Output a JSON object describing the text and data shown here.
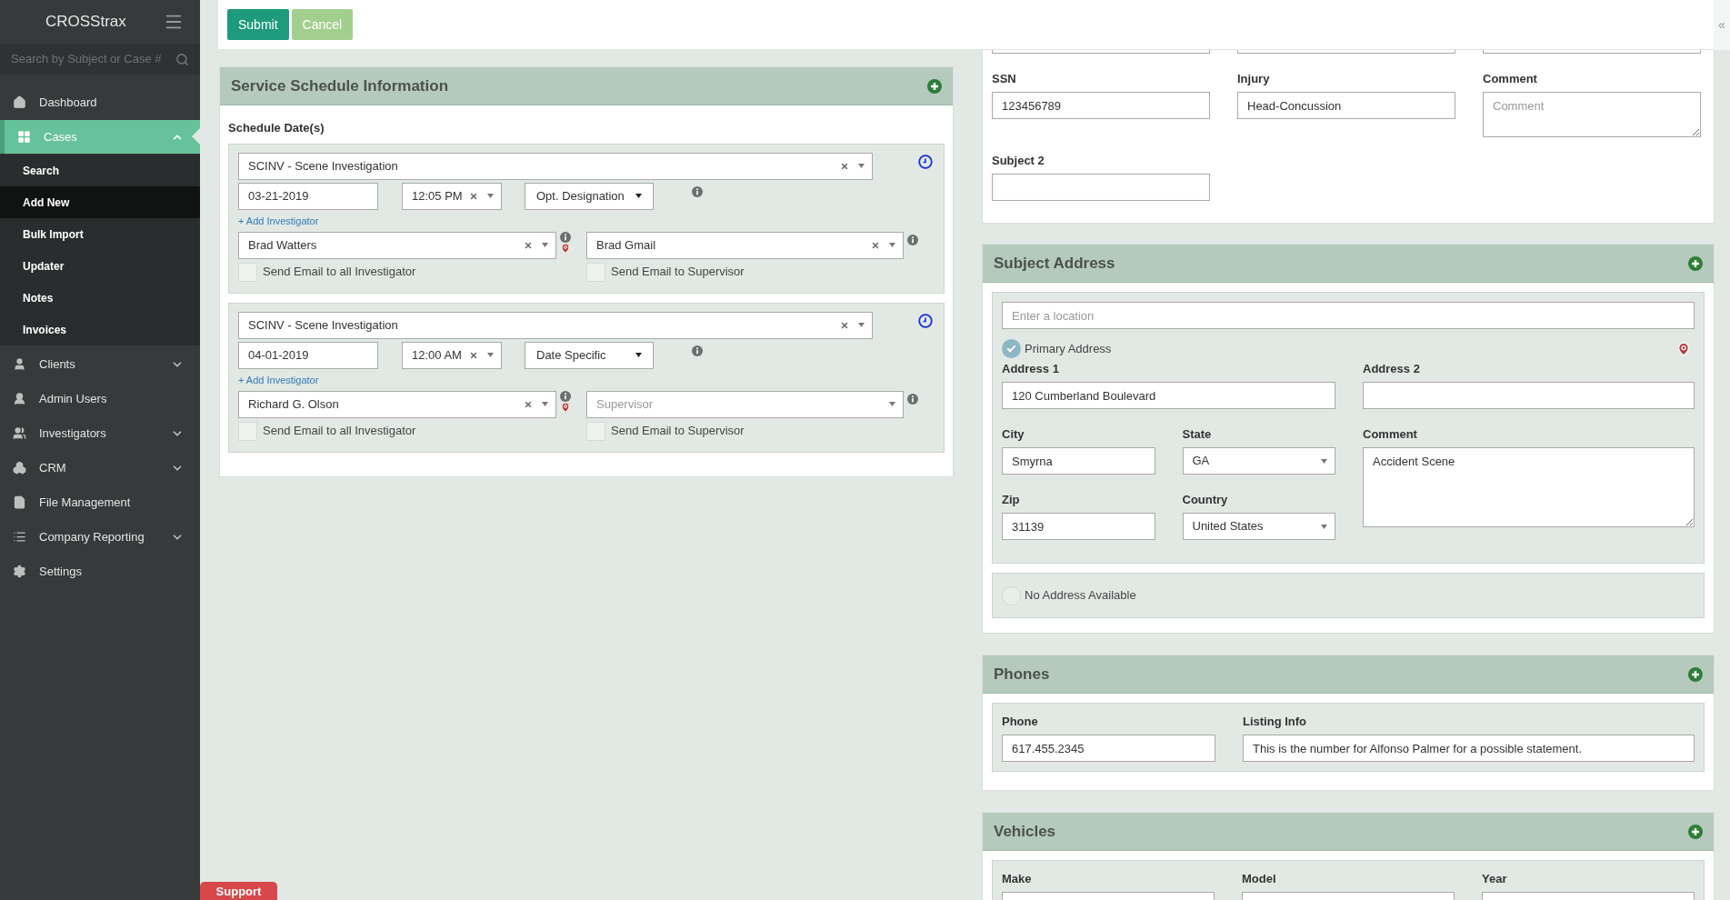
{
  "sidebar": {
    "brand": "CROSStrax",
    "search": {
      "placeholder": "Search by Subject or Case #"
    },
    "items": [
      {
        "label": "Dashboard",
        "selected": false
      },
      {
        "label": "Cases",
        "selected": true,
        "expanded": true,
        "children": [
          {
            "label": "Search",
            "selected": false
          },
          {
            "label": "Add New",
            "selected": true
          },
          {
            "label": "Bulk Import",
            "selected": false
          },
          {
            "label": "Updater",
            "selected": false
          },
          {
            "label": "Notes",
            "selected": false
          },
          {
            "label": "Invoices",
            "selected": false
          }
        ]
      },
      {
        "label": "Clients",
        "selected": false,
        "expanded": false
      },
      {
        "label": "Admin Users",
        "selected": false
      },
      {
        "label": "Investigators",
        "selected": false,
        "expanded": false
      },
      {
        "label": "CRM",
        "selected": false,
        "expanded": false
      },
      {
        "label": "File Management",
        "selected": false
      },
      {
        "label": "Company Reporting",
        "selected": false,
        "expanded": false
      },
      {
        "label": "Settings",
        "selected": false
      }
    ]
  },
  "toolbar": {
    "buttons": [
      {
        "label": "Submit",
        "kind": "primary"
      },
      {
        "label": "Cancel",
        "kind": "secondary"
      }
    ],
    "collapse": "«"
  },
  "schedule": {
    "title": "Service Schedule Information",
    "subtitle": "Schedule Date(s)",
    "entries": [
      {
        "service": "SCINV - Scene Investigation",
        "date": "03-21-2019",
        "time": "12:05 PM",
        "designation": "Opt. Designation",
        "add_link": "+ Add Investigator",
        "investigator": {
          "value": "Brad Watters"
        },
        "supervisor": {
          "value": "Brad Gmail"
        },
        "email_investigator": {
          "label": "Send Email to all Investigator",
          "checked": false
        },
        "email_supervisor": {
          "label": "Send Email to Supervisor",
          "checked": false
        }
      },
      {
        "service": "SCINV - Scene Investigation",
        "date": "04-01-2019",
        "time": "12:00 AM",
        "designation": "Date Specific",
        "add_link": "+ Add Investigator",
        "investigator": {
          "value": "Richard G. Olson"
        },
        "supervisor": {
          "placeholder": "Supervisor"
        },
        "email_investigator": {
          "label": "Send Email to all Investigator",
          "checked": false
        },
        "email_supervisor": {
          "label": "Send Email to Supervisor",
          "checked": false
        }
      }
    ]
  },
  "subject": {
    "fields": [
      {
        "label": "SSN",
        "value": "123456789",
        "kind": "input"
      },
      {
        "label": "Injury",
        "value": "Head-Concussion",
        "kind": "input"
      },
      {
        "label": "Comment",
        "placeholder": "Comment",
        "kind": "textarea"
      }
    ],
    "subject2": {
      "label": "Subject 2"
    }
  },
  "subject_address": {
    "title": "Subject Address",
    "location": {
      "placeholder": "Enter a location"
    },
    "primary": {
      "label": "Primary Address",
      "checked": true
    },
    "address1": {
      "label": "Address 1",
      "value": "120 Cumberland Boulevard"
    },
    "address2": {
      "label": "Address 2"
    },
    "city": {
      "label": "City",
      "value": "Smyrna"
    },
    "state": {
      "label": "State",
      "value": "GA"
    },
    "zip": {
      "label": "Zip",
      "value": "31139"
    },
    "country": {
      "label": "Country",
      "value": "United States"
    },
    "comment": {
      "label": "Comment",
      "value": "Accident Scene"
    },
    "no_address": {
      "label": "No Address Available",
      "checked": false
    }
  },
  "phones": {
    "title": "Phones",
    "columns": [
      "Phone",
      "Listing Info"
    ],
    "rows": [
      {
        "phone": "617.455.2345",
        "listing_info": "This is the number for Alfonso Palmer for a possible statement."
      }
    ]
  },
  "vehicles": {
    "title": "Vehicles",
    "columns": [
      "Make",
      "Model",
      "Year"
    ]
  },
  "support": {
    "label": "Support"
  }
}
